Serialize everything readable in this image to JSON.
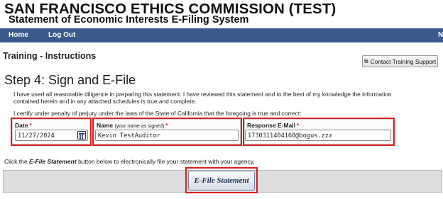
{
  "header": {
    "org_title": "SAN FRANCISCO ETHICS COMMISSION (TEST)",
    "system_title": "Statement of Economic Interests E-Filing System"
  },
  "nav": {
    "home": "Home",
    "logout": "Log Out",
    "more": "N"
  },
  "page": {
    "subtitle": "Training - Instructions",
    "step_title": "Step 4: Sign and E-File"
  },
  "support_button": {
    "label": "Contact Training Support",
    "icon": "support-icon"
  },
  "statements": {
    "diligence": "I have used all reasonable diligence in preparing this statement. I have reviewed this statement and to the best of my knowledge the information contained herein and in any attached schedules is true and complete.",
    "certify": "I certify under penalty of perjury under the laws of the State of California that the foregoing is true and correct:"
  },
  "fields": {
    "date": {
      "label": "Date",
      "required": "*",
      "value": "11/27/2024",
      "icon": "calendar-icon"
    },
    "name": {
      "label": "Name",
      "hint": "(your name as signed)",
      "required": "*",
      "value": "Kevin TestAuditor"
    },
    "email": {
      "label": "Response E-Mail",
      "required": "*",
      "value": "1730311404168@bogus.zzz"
    }
  },
  "instruction": {
    "prefix": "Click the ",
    "button_ref": "E-File Statement",
    "suffix": " button below to electronically file your statement with your agency."
  },
  "efile_button": {
    "label": "E-File Statement"
  },
  "colors": {
    "nav_bg": "#3a5a8c",
    "highlight": "#d61f1f",
    "required": "#d61f1f"
  }
}
